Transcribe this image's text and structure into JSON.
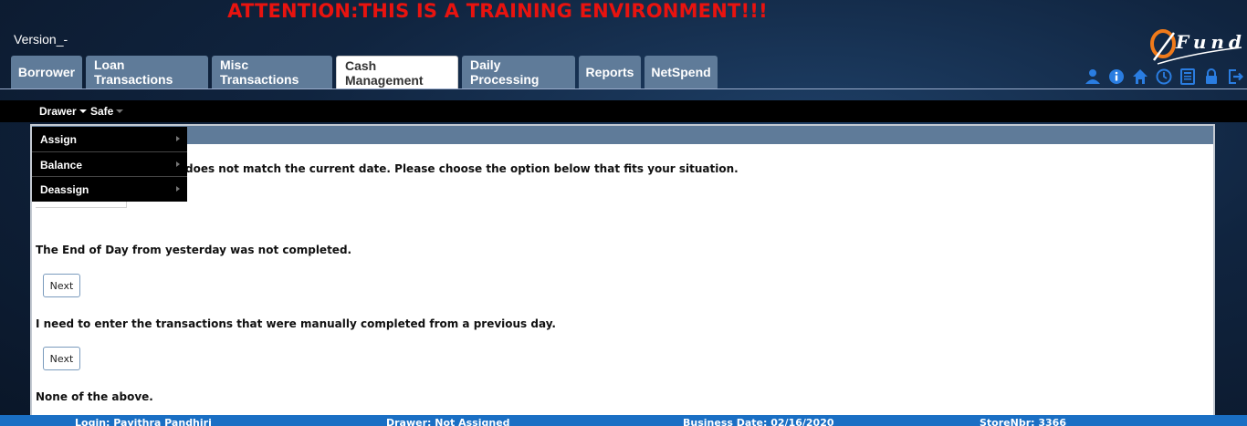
{
  "header": {
    "banner": "ATTENTION:THIS IS A TRAINING ENVIRONMENT!!!",
    "version": "Version_-",
    "logo_text": "Fund"
  },
  "tabs": [
    {
      "label": "Borrower",
      "active": false
    },
    {
      "label": "Loan Transactions",
      "active": false
    },
    {
      "label": "Misc Transactions",
      "active": false
    },
    {
      "label": "Cash Management",
      "active": true
    },
    {
      "label": "Daily Processing",
      "active": false
    },
    {
      "label": "Reports",
      "active": false
    },
    {
      "label": "NetSpend",
      "active": false
    }
  ],
  "utility_icons": [
    "user-icon",
    "info-icon",
    "home-icon",
    "clock-icon",
    "calculator-icon",
    "lock-icon",
    "logout-icon"
  ],
  "menubar": {
    "drawer": "Drawer",
    "safe": "Safe"
  },
  "dropdown": {
    "items": [
      "Assign",
      "Balance",
      "Deassign"
    ]
  },
  "content": {
    "message": "does not match the current date. Please choose the option below that fits your situation.",
    "option1": "The End of Day from yesterday was not completed.",
    "option2": "I need to enter the transactions that were manually completed from a previous day.",
    "option3": "None of the above.",
    "next_label": "Next"
  },
  "footer": {
    "login": "Login: Pavithra Pandhiri",
    "drawer": "Drawer: Not Assigned",
    "business_date": "Business Date: 02/16/2020",
    "store": "StoreNbr: 3366"
  },
  "colors": {
    "banner": "#e8130f",
    "tab": "#5f7b99",
    "footer": "#1a6fc4",
    "icons": "#2a7de1"
  }
}
